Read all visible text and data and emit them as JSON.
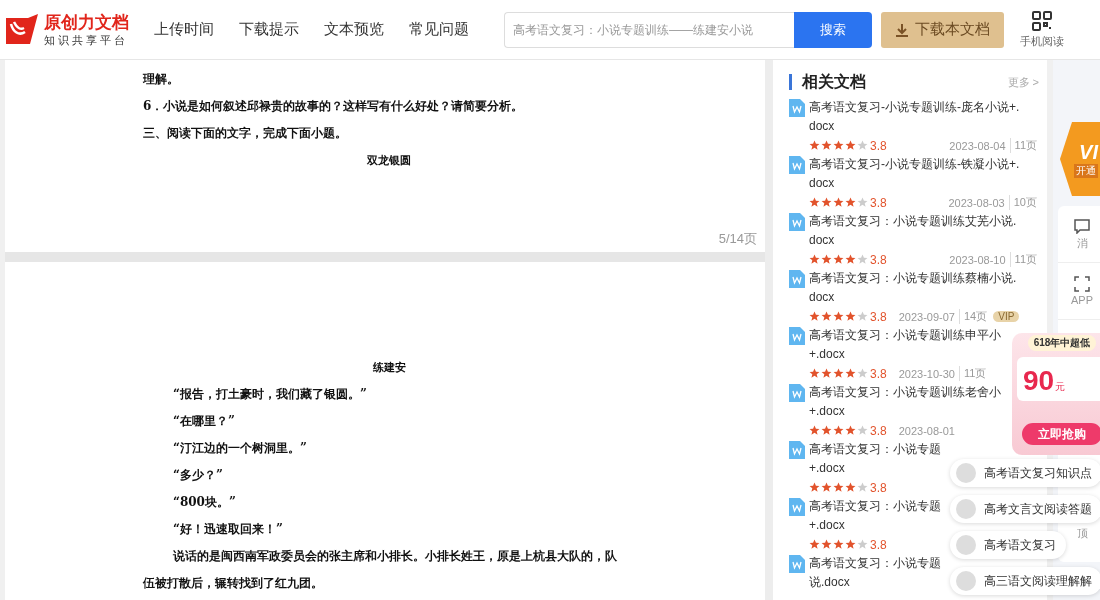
{
  "header": {
    "logo_title": "原创力文档",
    "logo_subtitle": "知识共享平台",
    "nav": [
      {
        "label": "上传时间"
      },
      {
        "label": "下载提示"
      },
      {
        "label": "文本预览"
      },
      {
        "label": "常见问题"
      }
    ],
    "search": {
      "placeholder": "高考语文复习：小说专题训练——练建安小说",
      "button": "搜索"
    },
    "download_button": "下载本文档",
    "mobile_label": "手机阅读"
  },
  "pages": [
    {
      "lines": [
        {
          "kind": "text",
          "text": "理解。"
        },
        {
          "kind": "text",
          "text": "6．小说是如何叙述邱禄贵的故事的？这样写有什么好处？请简要分析。"
        },
        {
          "kind": "text",
          "text": "三、阅读下面的文字，完成下面小题。"
        },
        {
          "kind": "title",
          "text": "双龙银圆"
        }
      ],
      "page_number": "5/14页"
    },
    {
      "lines": [
        {
          "kind": "title",
          "text": "练建安"
        },
        {
          "kind": "quote",
          "text": "“报告，打土豪时，我们藏了银圆。”"
        },
        {
          "kind": "quote",
          "text": "“在哪里？”"
        },
        {
          "kind": "quote",
          "text": "“汀江边的一个树洞里。”"
        },
        {
          "kind": "quote",
          "text": "“多少？”"
        },
        {
          "kind": "quote",
          "text": "“800块。”"
        },
        {
          "kind": "quote",
          "text": "“好！迅速取回来！”"
        },
        {
          "kind": "quote",
          "text": "说话的是闽西南军政委员会的张主席和小排长。小排长姓王，原是上杭县大队的，队"
        },
        {
          "kind": "text",
          "text": "伍被打散后，辗转找到了红九团。"
        }
      ]
    }
  ],
  "related": {
    "title": "相关文档",
    "more": "更多 >",
    "items": [
      {
        "lines": [
          "高考语文复习-小说专题训练-庞名小说+.",
          "docx"
        ],
        "stars": 4,
        "rating": "3.8",
        "date": "2023-08-04",
        "pages": "11页"
      },
      {
        "lines": [
          "高考语文复习-小说专题训练-铁凝小说+.",
          "docx"
        ],
        "stars": 4,
        "rating": "3.8",
        "date": "2023-08-03",
        "pages": "10页"
      },
      {
        "lines": [
          "高考语文复习：小说专题训练艾芜小说.",
          "docx"
        ],
        "stars": 4,
        "rating": "3.8",
        "date": "2023-08-10",
        "pages": "11页"
      },
      {
        "lines": [
          "高考语文复习：小说专题训练蔡楠小说.",
          "docx"
        ],
        "stars": 4,
        "rating": "3.8",
        "date": "2023-09-07",
        "pages": "14页",
        "badge": "VIP"
      },
      {
        "lines": [
          "高考语文复习：小说专题训练申平小",
          "+.docx"
        ],
        "stars": 4,
        "rating": "3.8",
        "date": "2023-10-30",
        "pages": "11页"
      },
      {
        "lines": [
          "高考语文复习：小说专题训练老舍小",
          "+.docx"
        ],
        "stars": 4,
        "rating": "3.8",
        "date": "2023-08-01"
      },
      {
        "lines": [
          "高考语文复习：小说专题",
          "+.docx"
        ],
        "stars": 4,
        "rating": "3.8"
      },
      {
        "lines": [
          "高考语文复习：小说专题",
          "+.docx"
        ],
        "stars": 4,
        "rating": "3.8"
      },
      {
        "lines": [
          "高考语文复习：小说专题",
          "说.docx"
        ]
      }
    ]
  },
  "side_strip": {
    "vip_badge": "VI",
    "vip_caption": "开通",
    "tools": [
      {
        "label": "消"
      },
      {
        "label": "APP"
      }
    ],
    "top_label": "顶"
  },
  "promo": {
    "headline": "618年中超低",
    "price": "90",
    "unit": "元",
    "button": "立即抢购"
  },
  "suggestions": [
    {
      "label": "高考语文复习知识点"
    },
    {
      "label": "高考文言文阅读答题"
    },
    {
      "label": "高考语文复习"
    },
    {
      "label": "高三语文阅读理解解"
    }
  ]
}
